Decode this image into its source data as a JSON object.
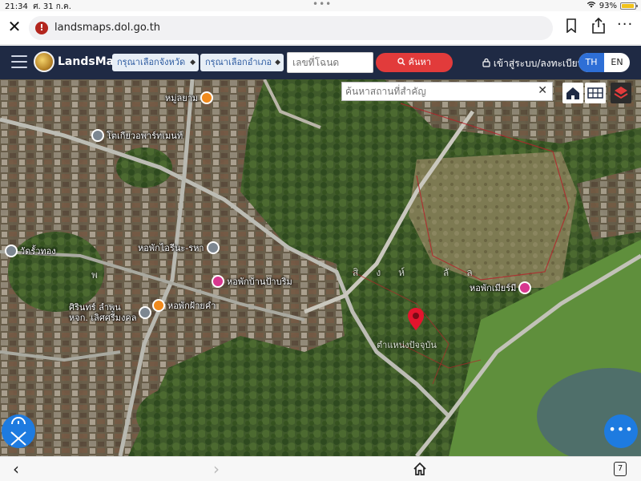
{
  "status_bar": {
    "time": "21:34",
    "date": "ศ. 31 ก.ค.",
    "battery": "93%",
    "battery_level": 0.93
  },
  "browser": {
    "url": "landsmaps.dol.go.th",
    "tab_count": "7"
  },
  "header": {
    "brand": "LandsMaps",
    "province_placeholder": "กรุณาเลือกจังหวัด",
    "district_placeholder": "กรุณาเลือกอำเภอ",
    "deed_placeholder": "เลขที่โฉนด",
    "search_label": "ค้นหา",
    "login_label": "เข้าสู่ระบบ/ลงทะเบียน",
    "lang_th": "TH",
    "lang_en": "EN"
  },
  "map": {
    "place_search_placeholder": "ค้นหาสถานที่สำคัญ",
    "pois": [
      {
        "label": "หมู่ลยาม",
        "color": "orange"
      },
      {
        "label": "โตเกียวอพาร์ทเมนท์",
        "color": "grey"
      },
      {
        "label": "หอพักไอรีนะ-รหา",
        "color": "grey"
      },
      {
        "label": "หอพักบ้านป้าบริม",
        "color": "pink"
      },
      {
        "label": "หอพักฝ้ายคำ",
        "color": "orange"
      },
      {
        "label": "ศิรินทร์ ลำพูน\nหจก. เลิศศรีมงคล",
        "color": "grey"
      },
      {
        "label": "วัดรั้วทอง",
        "color": "grey"
      },
      {
        "label": "หอพักเมียร์มี",
        "color": "pink"
      }
    ],
    "area_label": "สิงห์ ลัล",
    "marker_label": "ตำแหน่งปัจจุบัน",
    "left_edge_label": "พ"
  }
}
